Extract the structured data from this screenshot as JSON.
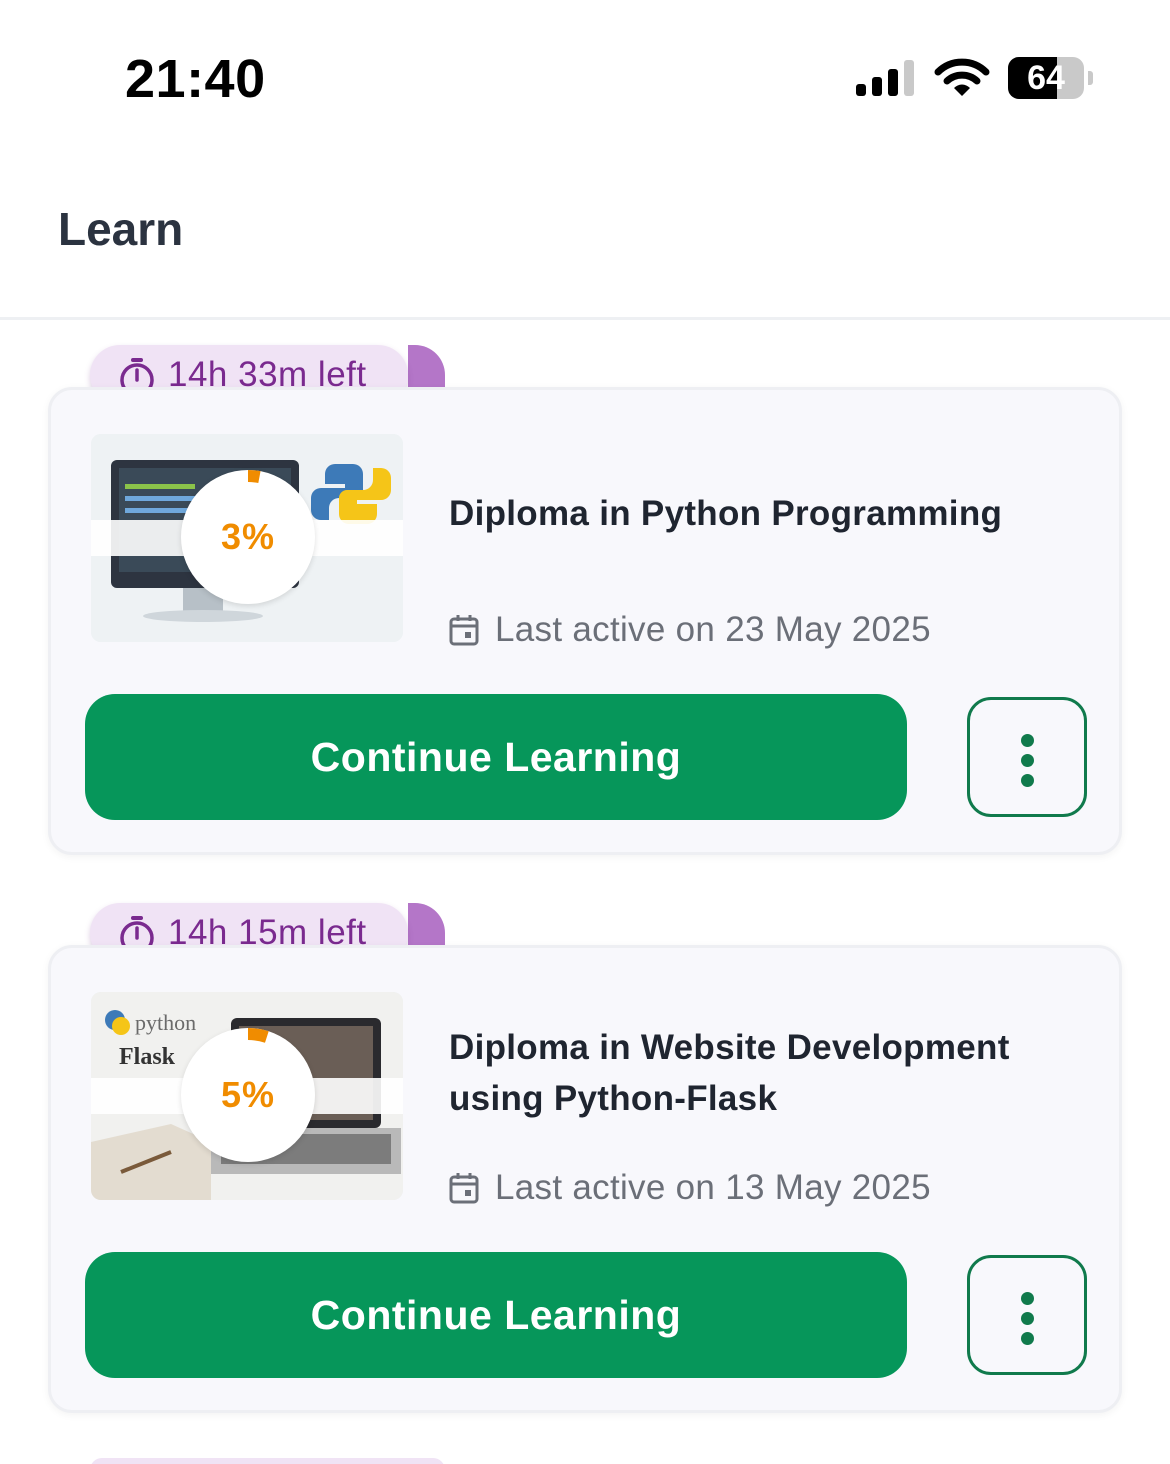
{
  "status_bar": {
    "time": "21:40",
    "battery": "64",
    "battery_level_percent": 64,
    "icons": [
      "cellular-signal-icon",
      "wifi-icon",
      "battery-icon"
    ]
  },
  "header": {
    "title": "Learn"
  },
  "courses": [
    {
      "time_left": "14h 33m left",
      "title": "Diploma in Python Programming",
      "progress_label": "3%",
      "progress_percent": 3,
      "last_active": "Last active on 23 May 2025",
      "cta_label": "Continue Learning"
    },
    {
      "time_left": "14h 15m left",
      "title": "Diploma in Website Development using Python-Flask",
      "progress_label": "5%",
      "progress_percent": 5,
      "last_active": "Last active on 13 May 2025",
      "cta_label": "Continue Learning"
    }
  ],
  "colors": {
    "accent_green": "#06965a",
    "timer_purple": "#7a2a8f",
    "progress_orange": "#f08c00"
  }
}
